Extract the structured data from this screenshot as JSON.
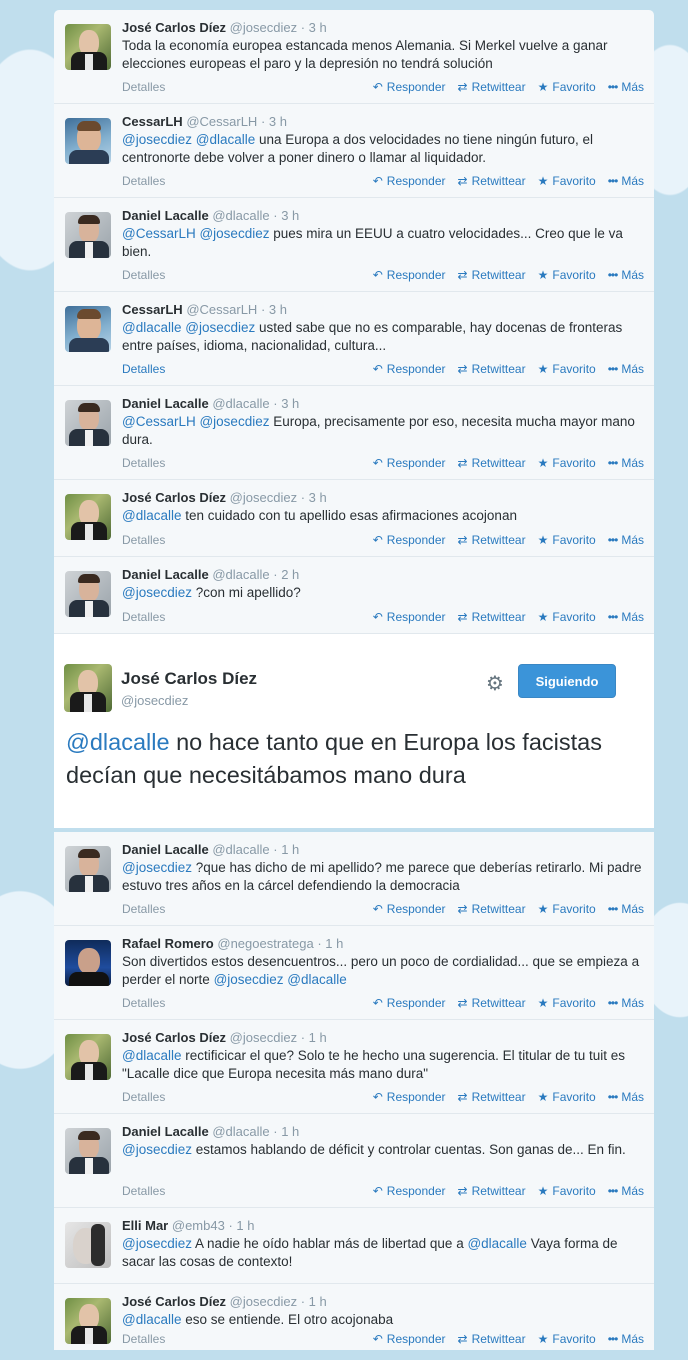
{
  "actions": {
    "details": "Detalles",
    "reply": "Responder",
    "retweet": "Retwittear",
    "favorite": "Favorito",
    "more": "Más"
  },
  "tweets_before": [
    {
      "name": "José Carlos Díez",
      "handle": "@josecdiez",
      "time": "· 3 h",
      "mentions": "",
      "text": "Toda la economía europea estancada menos Alemania. Si Merkel vuelve a ganar elecciones europeas el paro y la depresión no tendrá solución"
    },
    {
      "name": "CessarLH",
      "handle": "@CessarLH",
      "time": "· 3 h",
      "mentions": "@josecdiez @dlacalle",
      "text": " una Europa a dos velocidades no tiene ningún futuro, el centronorte debe volver a poner dinero o llamar al liquidador."
    },
    {
      "name": "Daniel Lacalle",
      "handle": "@dlacalle",
      "time": "· 3 h",
      "mentions": "@CessarLH @josecdiez",
      "text": " pues mira un EEUU a cuatro velocidades... Creo que le va bien."
    },
    {
      "name": "CessarLH",
      "handle": "@CessarLH",
      "time": "· 3 h",
      "mentions": "@dlacalle @josecdiez",
      "text": " usted sabe que no es comparable, hay docenas de fronteras entre países, idioma, nacionalidad, cultura..."
    },
    {
      "name": "Daniel Lacalle",
      "handle": "@dlacalle",
      "time": "· 3 h",
      "mentions": "@CessarLH @josecdiez",
      "text": " Europa, precisamente por eso, necesita mucha mayor mano dura."
    },
    {
      "name": "José Carlos Díez",
      "handle": "@josecdiez",
      "time": "· 3 h",
      "mentions": "@dlacalle",
      "text": " ten cuidado con tu apellido esas afirmaciones acojonan"
    },
    {
      "name": "Daniel Lacalle",
      "handle": "@dlacalle",
      "time": "· 2 h",
      "mentions": "@josecdiez",
      "text": " ?con mi apellido?"
    }
  ],
  "focused": {
    "name": "José Carlos Díez",
    "handle": "@josecdiez",
    "follow_label": "Siguiendo",
    "mention": "@dlacalle",
    "text": " no hace tanto que en Europa los facistas decían que necesitábamos mano dura"
  },
  "tweets_after": [
    {
      "name": "Daniel Lacalle",
      "handle": "@dlacalle",
      "time": "· 1 h",
      "mentions": "@josecdiez",
      "text": " ?que has dicho de mi apellido? me parece que deberías retirarlo. Mi padre estuvo tres años en la cárcel defendiendo la democracia"
    },
    {
      "name": "Rafael Romero",
      "handle": "@negoestratega",
      "time": "· 1 h",
      "mentions": "",
      "text": "Son divertidos estos desencuentros... pero un poco de cordialidad... que se empieza a perder el norte ",
      "trailing_mentions": "@josecdiez @dlacalle"
    },
    {
      "name": "José Carlos Díez",
      "handle": "@josecdiez",
      "time": "· 1 h",
      "mentions": "@dlacalle",
      "text": " rectificicar el que? Solo te he hecho una sugerencia. El titular de tu tuit es \"Lacalle dice que Europa necesita más mano dura\""
    },
    {
      "name": "Daniel Lacalle",
      "handle": "@dlacalle",
      "time": "· 1 h",
      "mentions": "@josecdiez",
      "text": " estamos hablando de déficit y controlar cuentas. Son ganas de... En fin."
    },
    {
      "name": "Elli Mar",
      "handle": "@emb43",
      "time": "· 1 h",
      "mentions": "@josecdiez",
      "text": " A nadie he oído hablar más de libertad que a ",
      "mid_mention": "@dlacalle",
      "text2": " Vaya forma de sacar las cosas de contexto!"
    },
    {
      "name": "José Carlos Díez",
      "handle": "@josecdiez",
      "time": "· 1 h",
      "mentions": "@dlacalle",
      "text": " eso se entiende. El otro acojonaba"
    }
  ]
}
